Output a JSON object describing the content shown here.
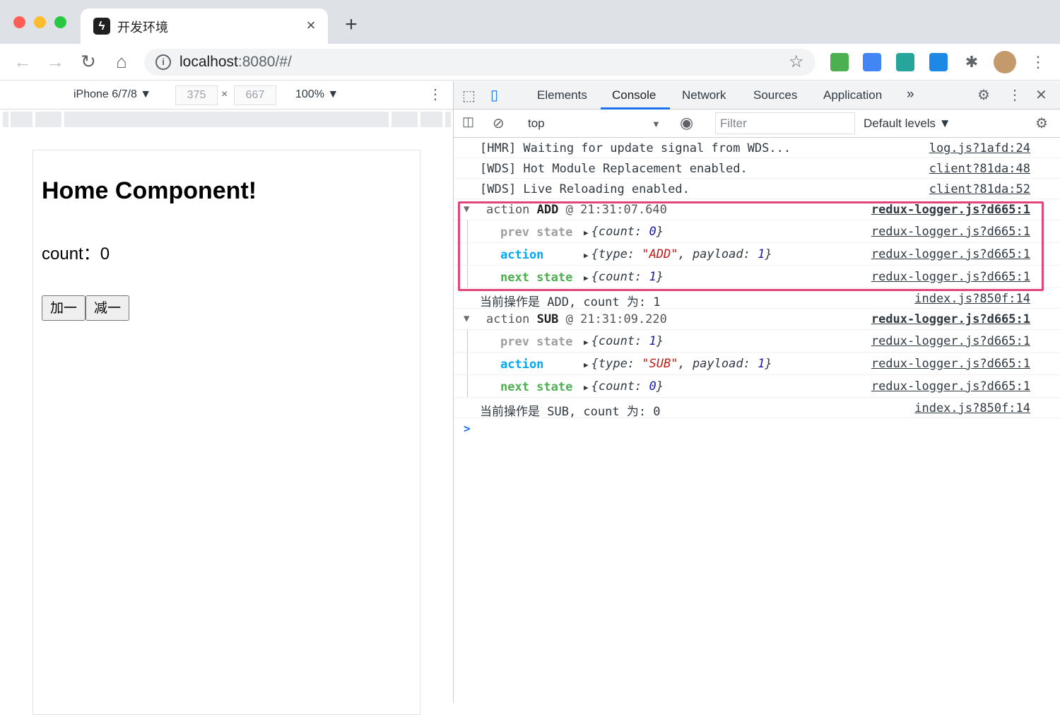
{
  "browser": {
    "tab_title": "开发环境",
    "tab_icon": "app-logo-icon",
    "new_tab_label": "+",
    "close_label": "×",
    "url_host": "localhost",
    "url_path": ":8080/#/"
  },
  "device_toolbar": {
    "device": "iPhone 6/7/8 ▼",
    "width": "375",
    "times": "×",
    "height": "667",
    "zoom": "100% ▼"
  },
  "page": {
    "title": "Home Component!",
    "count_line": "count：0",
    "add_button": "加一",
    "sub_button": "减一"
  },
  "devtools": {
    "tabs": [
      "Elements",
      "Console",
      "Network",
      "Sources",
      "Application"
    ],
    "more_tabs": "»",
    "context": "top",
    "context_caret": "▼",
    "filter_placeholder": "Filter",
    "levels": "Default levels ▼"
  },
  "console": {
    "lines": [
      {
        "text": "[HMR] Waiting for update signal from WDS...",
        "src": "log.js?1afd:24"
      },
      {
        "text": "[WDS] Hot Module Replacement enabled.",
        "src": "client?81da:48"
      },
      {
        "text": "[WDS] Live Reloading enabled.",
        "src": "client?81da:52"
      }
    ],
    "groups": [
      {
        "head_prefix": "action ",
        "head_type": "ADD",
        "head_suffix": " @ 21:31:07.640",
        "src": "redux-logger.js?d665:1",
        "prev_label": "prev state",
        "prev_key": "{count: ",
        "prev_val": "0",
        "prev_end": "}",
        "action_label": "action",
        "action_key": "{type: ",
        "action_type": "\"ADD\"",
        "action_mid": ", payload: ",
        "action_payload": "1",
        "action_end": "}",
        "next_label": "next state",
        "next_key": "{count: ",
        "next_val": "1",
        "next_end": "}",
        "log_text": "当前操作是 ADD, count 为: 1",
        "log_src": "index.js?850f:14"
      },
      {
        "head_prefix": "action ",
        "head_type": "SUB",
        "head_suffix": " @ 21:31:09.220",
        "src": "redux-logger.js?d665:1",
        "prev_label": "prev state",
        "prev_key": "{count: ",
        "prev_val": "1",
        "prev_end": "}",
        "action_label": "action",
        "action_key": "{type: ",
        "action_type": "\"SUB\"",
        "action_mid": ", payload: ",
        "action_payload": "1",
        "action_end": "}",
        "next_label": "next state",
        "next_key": "{count: ",
        "next_val": "0",
        "next_end": "}",
        "log_text": "当前操作是 SUB, count 为: 0",
        "log_src": "index.js?850f:14"
      }
    ],
    "prompt": ">"
  },
  "colors": {
    "highlight": "#e0457b",
    "accent": "#1a73e8",
    "prev_state": "#9e9e9e",
    "action": "#03a9f4",
    "next_state": "#4caf50"
  }
}
